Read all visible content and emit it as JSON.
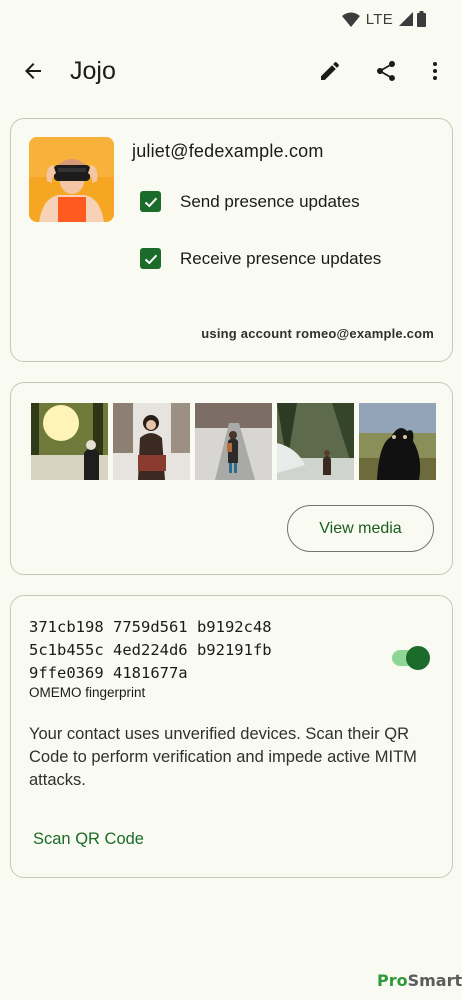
{
  "status_bar": {
    "network": "LTE"
  },
  "app_bar": {
    "title": "Jojo",
    "icons": [
      "back-arrow-icon",
      "edit-icon",
      "share-icon",
      "more-vert-icon"
    ]
  },
  "profile": {
    "jid": "juliet@fedexample.com",
    "send_presence_label": "Send presence updates",
    "send_presence_checked": true,
    "receive_presence_label": "Receive presence updates",
    "receive_presence_checked": true,
    "account_line": "using account romeo@example.com"
  },
  "media": {
    "thumbnails": [
      "forest-sunset-hiker",
      "snowy-woman-coat",
      "snowy-road-walker",
      "forest-river-hiker",
      "black-dog"
    ],
    "view_media_label": "View media"
  },
  "omemo": {
    "fingerprint_lines": [
      "371cb198 7759d561 b9192c48",
      "5c1b455c 4ed224d6 b92191fb",
      "9ffe0369 4181677a"
    ],
    "fingerprint_label": "OMEMO fingerprint",
    "trusted": true,
    "warning": "Your contact uses unverified devices. Scan their QR Code to perform verification and impede active MITM attacks.",
    "scan_label": "Scan QR Code"
  },
  "watermark": {
    "part1": "Pro",
    "part2": "Smart"
  },
  "colors": {
    "accent": "#1b6b2a",
    "background": "#f9faf1",
    "outline": "#c6c8bc"
  }
}
